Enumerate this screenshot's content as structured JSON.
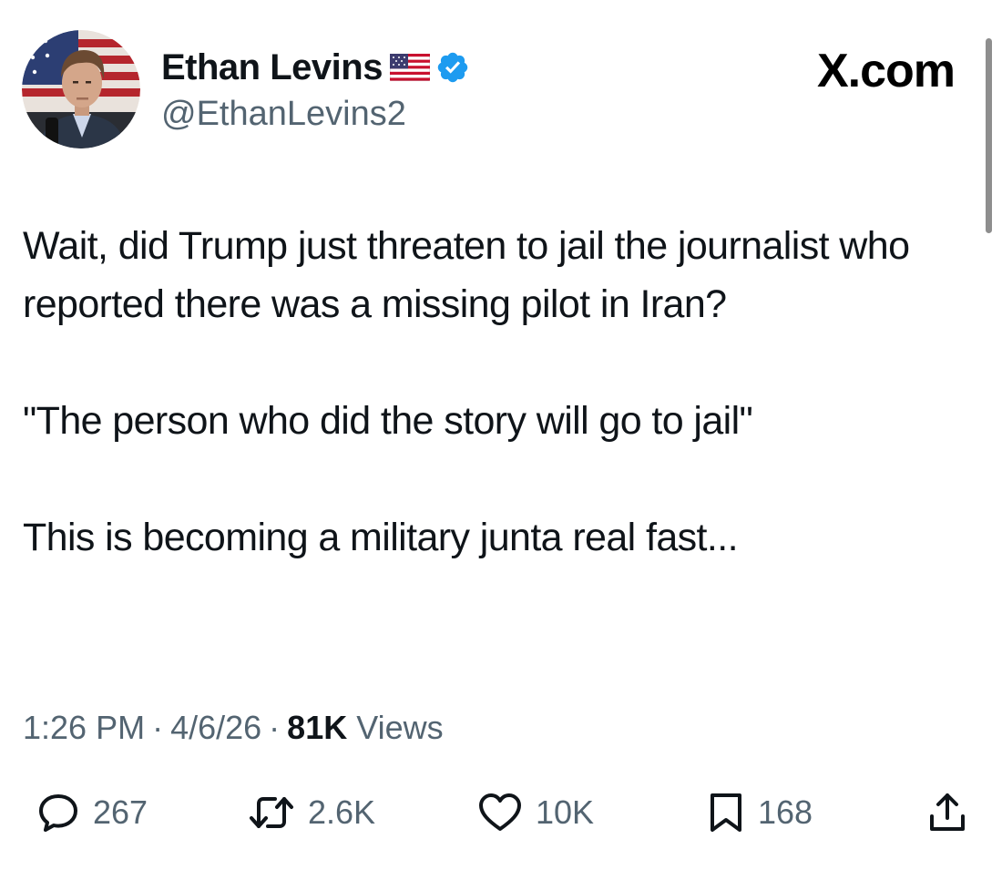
{
  "author": {
    "name": "Ethan Levins",
    "handle": "@EthanLevins2"
  },
  "brand": "X.com",
  "post": {
    "paragraphs": [
      "Wait, did Trump just threaten to jail the journalist who reported there was a missing pilot in Iran?",
      "\"The person who did the story will go to jail\"",
      "This is becoming a military junta real fast..."
    ]
  },
  "meta": {
    "time": "1:26 PM",
    "separator": "·",
    "date": "4/6/26",
    "views_count": "81K",
    "views_label": "Views"
  },
  "actions": {
    "replies": "267",
    "reposts": "2.6K",
    "likes": "10K",
    "bookmarks": "168"
  },
  "icons": {
    "flag": "us-flag-emoji",
    "verified": "verified-badge-icon",
    "reply": "speech-bubble-icon",
    "repost": "repost-arrows-icon",
    "like": "heart-icon",
    "bookmark": "bookmark-icon",
    "share": "share-upload-icon"
  },
  "colors": {
    "text_primary": "#0f1419",
    "text_secondary": "#536471",
    "verified_blue": "#1d9bf0"
  }
}
